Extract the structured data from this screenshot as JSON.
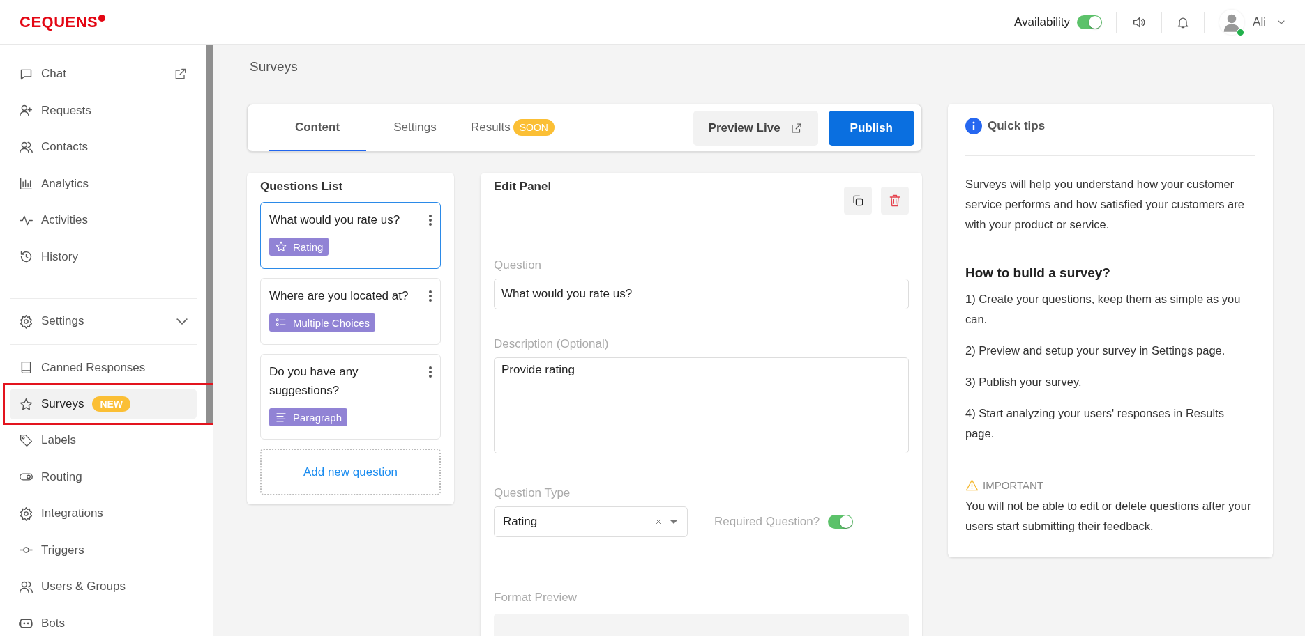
{
  "header": {
    "logo": "CEQUENS",
    "availability": {
      "label": "Availability",
      "on": true
    },
    "user": {
      "name": "Ali",
      "online": true
    }
  },
  "sidebar": {
    "sections": [
      {
        "items": [
          {
            "label": "Chat",
            "selected": false,
            "external": true
          },
          {
            "label": "Requests",
            "selected": false
          },
          {
            "label": "Contacts",
            "selected": false
          },
          {
            "label": "Analytics",
            "selected": false
          },
          {
            "label": "Activities",
            "selected": false
          },
          {
            "label": "History",
            "selected": false
          }
        ]
      },
      {
        "items": [
          {
            "label": "Settings",
            "selected": false,
            "expanded": false
          }
        ]
      },
      {
        "items": [
          {
            "label": "Canned Responses",
            "selected": false
          },
          {
            "label": "Surveys",
            "selected": true,
            "badge": "NEW",
            "annotated": true
          },
          {
            "label": "Labels",
            "selected": false
          },
          {
            "label": "Routing",
            "selected": false
          },
          {
            "label": "Integrations",
            "selected": false
          },
          {
            "label": "Triggers",
            "selected": false
          },
          {
            "label": "Users & Groups",
            "selected": false
          },
          {
            "label": "Bots",
            "selected": false
          }
        ]
      }
    ]
  },
  "page_title": "Surveys",
  "tabs": [
    {
      "label": "Content",
      "selected": true
    },
    {
      "label": "Settings",
      "selected": false
    },
    {
      "label": "Results",
      "selected": false,
      "badge": "SOON"
    }
  ],
  "actions": [
    {
      "label": "Preview Live",
      "kind": "secondary"
    },
    {
      "label": "Publish",
      "kind": "primary"
    }
  ],
  "questions_list": {
    "title": "Questions List",
    "questions": [
      {
        "text": "What would you rate us?",
        "type": "Rating",
        "kind": "rating",
        "selected": true
      },
      {
        "text": "Where are you located at?",
        "type": "Multiple Choices",
        "kind": "choices",
        "selected": false
      },
      {
        "text": "Do you have any suggestions?",
        "type": "Paragraph",
        "kind": "paragraph",
        "selected": false
      }
    ],
    "add_button": "Add new question"
  },
  "edit_panel": {
    "title": "Edit Panel",
    "question_label": "Question",
    "question_value": "What would you rate us?",
    "description_label": "Description (Optional)",
    "description_value": "Provide rating",
    "type_label": "Question Type",
    "type_value": "Rating",
    "required_label": "Required Question?",
    "required": true,
    "preview_label": "Format Preview"
  },
  "quick_tips": {
    "title": "Quick tips",
    "intro": "Surveys will help you understand how your customer service performs and how satisfied your customers are with your product or service.",
    "heading": "How to build a survey?",
    "steps": [
      "1) Create your questions, keep them as simple as you can.",
      "2) Preview and setup your survey in Settings page.",
      "3) Publish your survey.",
      "4) Start analyzing your users' responses in Results page."
    ],
    "important_label": "IMPORTANT",
    "important_text": "You will not be able to edit or delete questions after your users start submitting their feedback."
  }
}
